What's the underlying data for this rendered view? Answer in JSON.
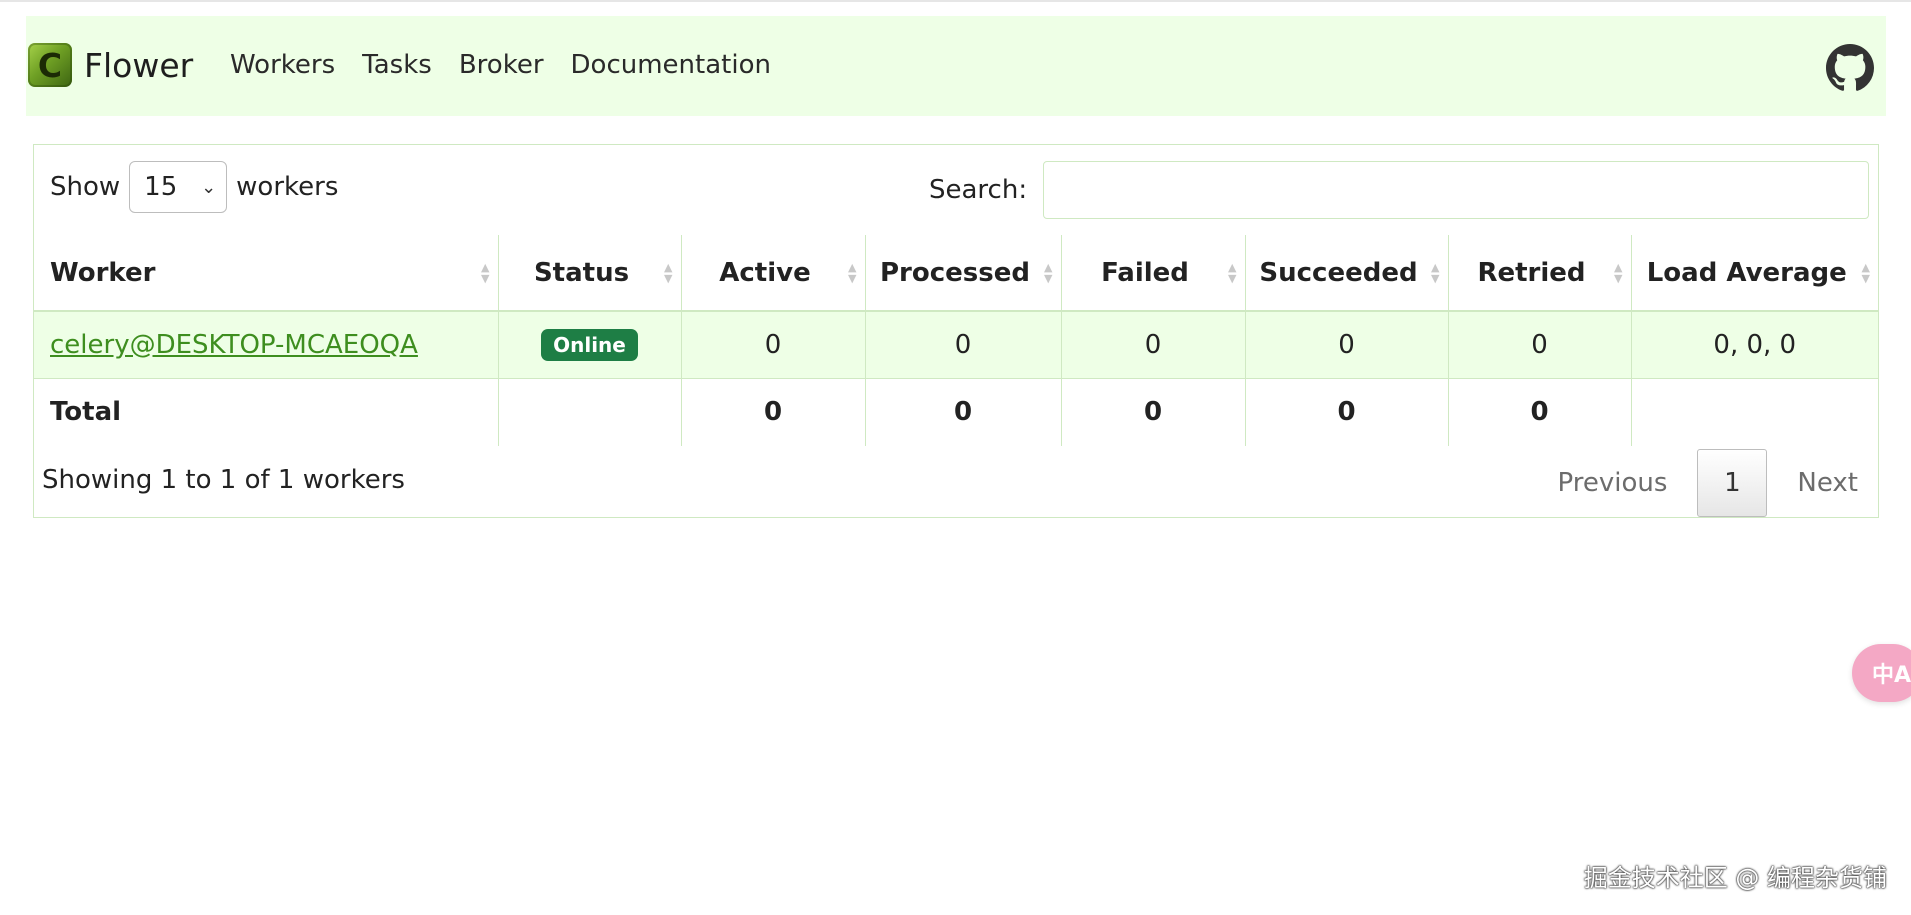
{
  "navbar": {
    "brand_logo_letter": "C",
    "brand": "Flower",
    "links": [
      "Workers",
      "Tasks",
      "Broker",
      "Documentation"
    ]
  },
  "controls": {
    "show_label": "Show",
    "page_size": "15",
    "show_suffix": "workers",
    "search_label": "Search:",
    "search_value": ""
  },
  "table": {
    "columns": [
      "Worker",
      "Status",
      "Active",
      "Processed",
      "Failed",
      "Succeeded",
      "Retried",
      "Load Average"
    ],
    "rows": [
      {
        "worker": "celery@DESKTOP-MCAEOQA",
        "status": "Online",
        "active": "0",
        "processed": "0",
        "failed": "0",
        "succeeded": "0",
        "retried": "0",
        "load_average": "0, 0, 0"
      }
    ],
    "total": {
      "label": "Total",
      "active": "0",
      "processed": "0",
      "failed": "0",
      "succeeded": "0",
      "retried": "0"
    }
  },
  "footer": {
    "info": "Showing 1 to 1 of 1 workers",
    "previous": "Previous",
    "current_page": "1",
    "next": "Next"
  },
  "translate_button": {
    "label": "中A"
  },
  "watermark": "掘金技术社区 @ 编程杂货铺",
  "colors": {
    "navbar_bg": "#eeffe6",
    "row_bg": "#eeffe6",
    "border": "#cfe9c2",
    "link": "#3e8e1f",
    "status_online": "#1e7e45"
  },
  "icons": {
    "brand": "celery-logo-icon",
    "github": "github-icon",
    "sort": "sort-icon",
    "select_chevron": "chevron-down-icon",
    "translate": "translate-icon"
  }
}
